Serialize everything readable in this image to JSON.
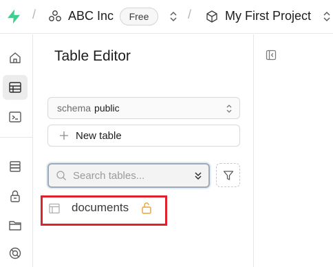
{
  "header": {
    "org_name": "ABC Inc",
    "plan_badge": "Free",
    "project_name": "My First Project",
    "separator": "/"
  },
  "nav_rail": {
    "items": [
      {
        "name": "home",
        "icon": "home-icon",
        "active": false
      },
      {
        "name": "table-editor",
        "icon": "table-icon",
        "active": true
      },
      {
        "name": "sql-editor",
        "icon": "terminal-icon",
        "active": false
      },
      {
        "name": "database",
        "icon": "database-icon",
        "active": false
      },
      {
        "name": "auth",
        "icon": "lock-icon",
        "active": false
      },
      {
        "name": "storage",
        "icon": "folder-icon",
        "active": false
      },
      {
        "name": "realtime",
        "icon": "realtime-icon",
        "active": false
      }
    ]
  },
  "panel": {
    "title": "Table Editor",
    "schema_label": "schema",
    "schema_value": "public",
    "new_table_label": "New table",
    "search_placeholder": "Search tables...",
    "tables": [
      {
        "name": "documents",
        "icon": "table-icon",
        "status_icon": "unlocked-icon"
      }
    ]
  },
  "colors": {
    "accent_green": "#3ecf8e",
    "highlight_red": "#e0202b",
    "lock_orange": "#f0a030"
  }
}
